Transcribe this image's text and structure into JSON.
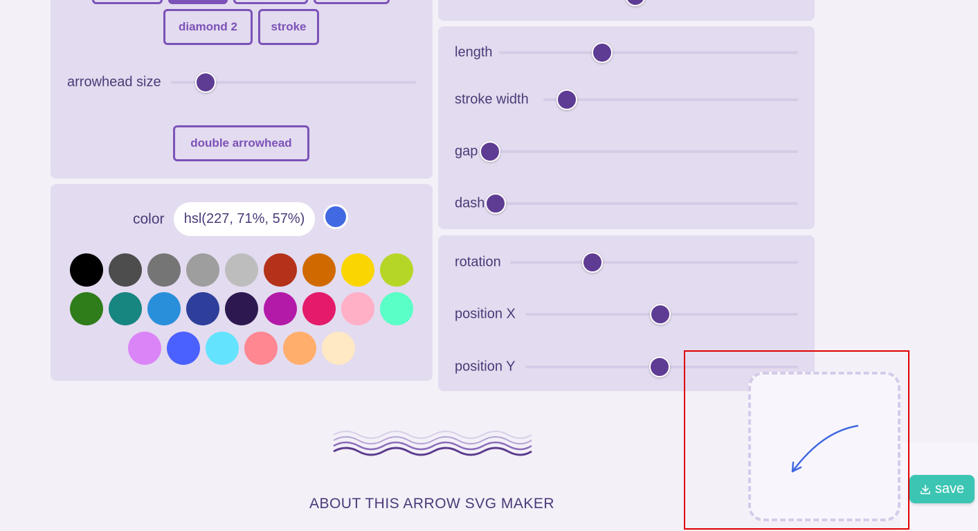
{
  "shape_options": {
    "buttons": [
      "diamond 2",
      "stroke"
    ],
    "arrowhead_size_label": "arrowhead size",
    "arrowhead_size_value": 0.14,
    "double_arrowhead_label": "double arrowhead"
  },
  "color_section": {
    "label": "color",
    "value": "hsl(227, 71%, 57%)",
    "preview_color": "#4169e1",
    "swatches": [
      "#000000",
      "#4d4d4d",
      "#757575",
      "#9e9e9e",
      "#bdbdbd",
      "#b33219",
      "#d06a00",
      "#fbd500",
      "#b6d627",
      "#2f7d1a",
      "#178580",
      "#2a8fdb",
      "#2d3f9a",
      "#2d1850",
      "#b31aa8",
      "#e31b6a",
      "#ffafc6",
      "#5affc7",
      "#db84f8",
      "#4a60ff",
      "#64e3ff",
      "#ff8791",
      "#ffae6b",
      "#ffe8c4"
    ]
  },
  "line_settings": {
    "sliders": [
      {
        "label": "length",
        "value": 0.35
      },
      {
        "label": "stroke width",
        "value": 0.08
      },
      {
        "label": "gap",
        "value": 0.0
      },
      {
        "label": "dash",
        "value": 0.0
      }
    ]
  },
  "transform_settings": {
    "sliders": [
      {
        "label": "rotation",
        "value": 0.3
      },
      {
        "label": "position X",
        "value": 0.5
      },
      {
        "label": "position Y",
        "value": 0.5
      }
    ]
  },
  "about_heading": "ABOUT THIS ARROW SVG MAKER",
  "save_button": {
    "label": "save",
    "icon": "download-icon"
  },
  "preview": {
    "arrow_color": "#4169e1",
    "highlight_color": "#e00000"
  }
}
